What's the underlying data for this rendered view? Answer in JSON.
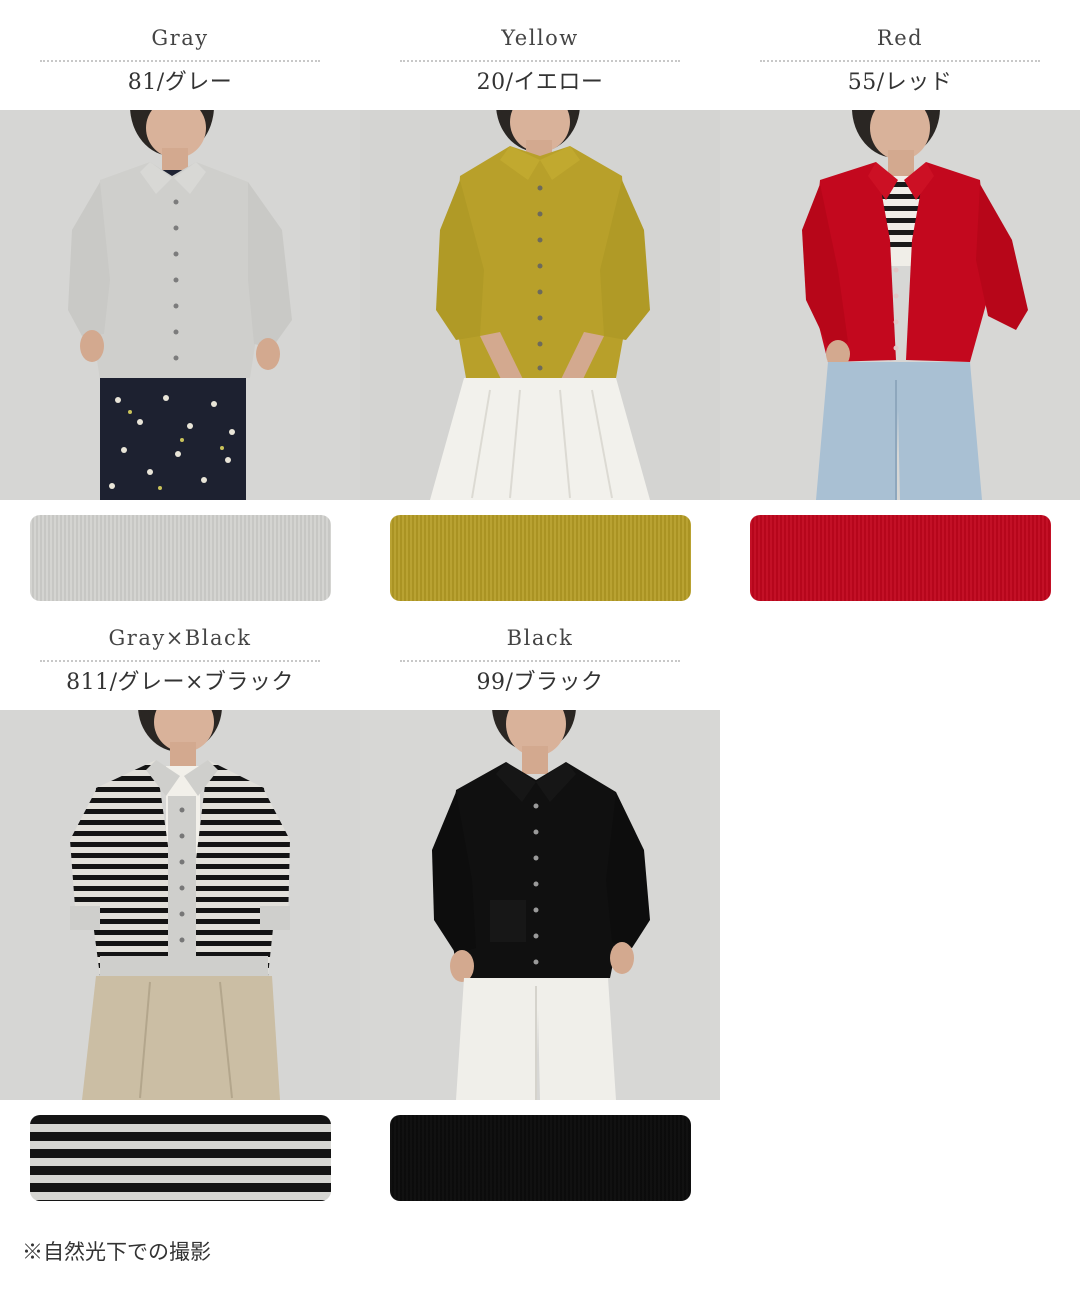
{
  "colors": [
    {
      "name_en": "Gray",
      "name_jp": "81/グレー",
      "swatch_color": "#cfcfcc",
      "garment_color": "#cfcfcc"
    },
    {
      "name_en": "Yellow",
      "name_jp": "20/イエロー",
      "swatch_color": "#b59c25",
      "garment_color": "#b8a02a"
    },
    {
      "name_en": "Red",
      "name_jp": "55/レッド",
      "swatch_color": "#c1061d",
      "garment_color": "#c3081e"
    },
    {
      "name_en": "Gray×Black",
      "name_jp": "811/グレー×ブラック",
      "swatch_color": "#151515",
      "garment_color": "#1a1a1a"
    },
    {
      "name_en": "Black",
      "name_jp": "99/ブラック",
      "swatch_color": "#0c0c0c",
      "garment_color": "#101010"
    }
  ],
  "note": "※自然光下での撮影"
}
